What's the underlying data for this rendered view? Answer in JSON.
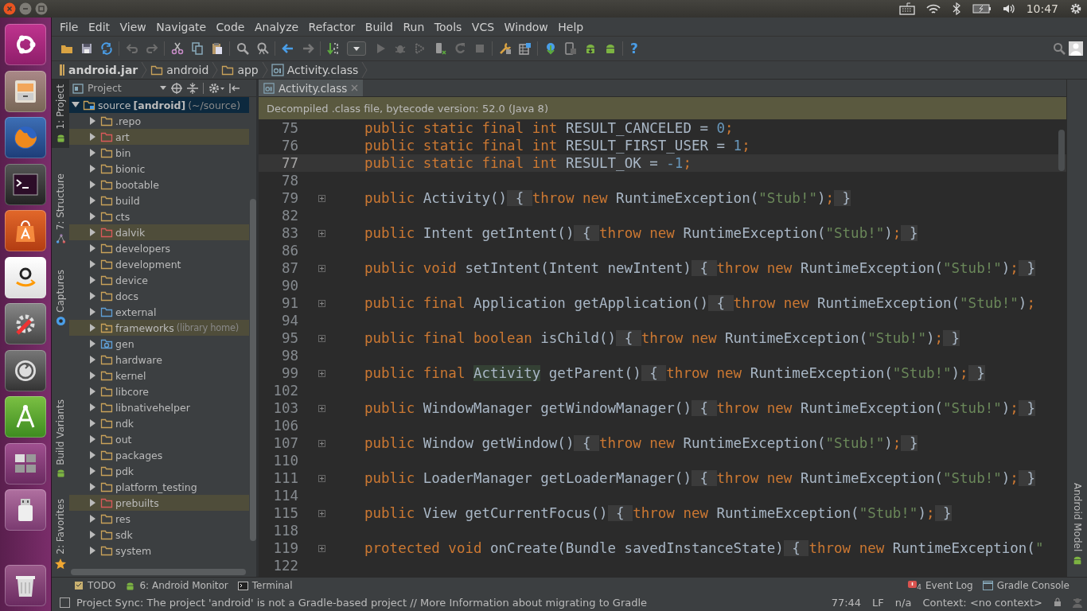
{
  "top_panel": {
    "clock": "10:47"
  },
  "menu": [
    "File",
    "Edit",
    "View",
    "Navigate",
    "Code",
    "Analyze",
    "Refactor",
    "Build",
    "Run",
    "Tools",
    "VCS",
    "Window",
    "Help"
  ],
  "toolbar": {
    "help_label": "?"
  },
  "breadcrumb": [
    {
      "label": "android.jar",
      "kind": "jar"
    },
    {
      "label": "android",
      "kind": "folder"
    },
    {
      "label": "app",
      "kind": "folder"
    },
    {
      "label": "Activity.class",
      "kind": "class"
    }
  ],
  "tool_tabs_left": [
    {
      "label": "1: Project",
      "selected": true
    },
    {
      "label": "7: Structure",
      "selected": false
    },
    {
      "label": "Captures",
      "selected": false
    },
    {
      "label": "Build Variants",
      "selected": false
    },
    {
      "label": "2: Favorites",
      "selected": false
    }
  ],
  "tool_tabs_right": [
    {
      "label": "Android Model",
      "selected": false
    }
  ],
  "project_panel": {
    "title": "Project",
    "root": {
      "name": "source",
      "module": "[android]",
      "path": "(~/source)",
      "expanded": true,
      "selected": true,
      "children": [
        {
          "label": ".repo",
          "kind": "folder",
          "expanded": false,
          "highlighted": false
        },
        {
          "label": "art",
          "kind": "excluded",
          "expanded": false,
          "highlighted": true
        },
        {
          "label": "bin",
          "kind": "folder",
          "expanded": false,
          "highlighted": false
        },
        {
          "label": "bionic",
          "kind": "folder",
          "expanded": false,
          "highlighted": false
        },
        {
          "label": "bootable",
          "kind": "folder",
          "expanded": false,
          "highlighted": false
        },
        {
          "label": "build",
          "kind": "folder",
          "expanded": false,
          "highlighted": false
        },
        {
          "label": "cts",
          "kind": "folder",
          "expanded": false,
          "highlighted": false
        },
        {
          "label": "dalvik",
          "kind": "excluded",
          "expanded": false,
          "highlighted": true
        },
        {
          "label": "developers",
          "kind": "folder",
          "expanded": false,
          "highlighted": false
        },
        {
          "label": "development",
          "kind": "folder",
          "expanded": false,
          "highlighted": false
        },
        {
          "label": "device",
          "kind": "folder",
          "expanded": false,
          "highlighted": false
        },
        {
          "label": "docs",
          "kind": "folder",
          "expanded": false,
          "highlighted": false
        },
        {
          "label": "external",
          "kind": "external",
          "expanded": false,
          "highlighted": false
        },
        {
          "label": "frameworks",
          "note": "(library home)",
          "kind": "library",
          "expanded": false,
          "highlighted": true
        },
        {
          "label": "gen",
          "kind": "generated",
          "expanded": false,
          "highlighted": false
        },
        {
          "label": "hardware",
          "kind": "folder",
          "expanded": false,
          "highlighted": false
        },
        {
          "label": "kernel",
          "kind": "folder",
          "expanded": false,
          "highlighted": false
        },
        {
          "label": "libcore",
          "kind": "folder",
          "expanded": false,
          "highlighted": false
        },
        {
          "label": "libnativehelper",
          "kind": "folder",
          "expanded": false,
          "highlighted": false
        },
        {
          "label": "ndk",
          "kind": "folder",
          "expanded": false,
          "highlighted": false
        },
        {
          "label": "out",
          "kind": "folder",
          "expanded": false,
          "highlighted": false
        },
        {
          "label": "packages",
          "kind": "folder",
          "expanded": false,
          "highlighted": false
        },
        {
          "label": "pdk",
          "kind": "folder",
          "expanded": false,
          "highlighted": false
        },
        {
          "label": "platform_testing",
          "kind": "folder",
          "expanded": false,
          "highlighted": false
        },
        {
          "label": "prebuilts",
          "kind": "excluded",
          "expanded": false,
          "highlighted": true
        },
        {
          "label": "res",
          "kind": "folder",
          "expanded": false,
          "highlighted": false
        },
        {
          "label": "sdk",
          "kind": "folder",
          "expanded": false,
          "highlighted": false
        },
        {
          "label": "system",
          "kind": "folder",
          "expanded": false,
          "highlighted": false
        }
      ]
    }
  },
  "editor": {
    "tabs": [
      {
        "label": "Activity.class",
        "selected": true
      }
    ],
    "banner": "Decompiled .class file, bytecode version: 52.0 (Java 8)",
    "lines": [
      {
        "number": "75",
        "current": false,
        "tokens": [
          {
            "kind": "keyword",
            "text": "public static final int "
          },
          {
            "kind": "name",
            "text": "RESULT_CANCELED = "
          },
          {
            "kind": "number",
            "text": "0"
          },
          {
            "kind": "semicolon",
            "text": ";"
          }
        ]
      },
      {
        "number": "76",
        "current": false,
        "tokens": [
          {
            "kind": "keyword",
            "text": "public static final int "
          },
          {
            "kind": "name",
            "text": "RESULT_FIRST_USER = "
          },
          {
            "kind": "number",
            "text": "1"
          },
          {
            "kind": "semicolon",
            "text": ";"
          }
        ]
      },
      {
        "number": "77",
        "current": true,
        "tokens": [
          {
            "kind": "keyword",
            "text": "public static final int "
          },
          {
            "kind": "name",
            "text": "RESULT_OK = "
          },
          {
            "kind": "number",
            "text": "-1"
          },
          {
            "kind": "semicolon",
            "text": ";"
          }
        ]
      },
      {
        "number": "78",
        "current": false
      },
      {
        "number": "79",
        "current": false,
        "tokens": [
          {
            "kind": "keyword",
            "text": "public "
          },
          {
            "kind": "name",
            "text": "Activity()"
          },
          {
            "kind": "fold",
            "text": " { "
          },
          {
            "kind": "keyword",
            "text": "throw new "
          },
          {
            "kind": "name",
            "text": "RuntimeException("
          },
          {
            "kind": "string",
            "text": "\"Stub!\""
          },
          {
            "kind": "name",
            "text": ")"
          },
          {
            "kind": "semicolon",
            "text": ";"
          },
          {
            "kind": "fold",
            "text": " }"
          }
        ]
      },
      {
        "number": "82",
        "current": false
      },
      {
        "number": "83",
        "current": false,
        "tokens": [
          {
            "kind": "keyword",
            "text": "public "
          },
          {
            "kind": "name",
            "text": "Intent getIntent()"
          },
          {
            "kind": "fold",
            "text": " { "
          },
          {
            "kind": "keyword",
            "text": "throw new "
          },
          {
            "kind": "name",
            "text": "RuntimeException("
          },
          {
            "kind": "string",
            "text": "\"Stub!\""
          },
          {
            "kind": "name",
            "text": ")"
          },
          {
            "kind": "semicolon",
            "text": ";"
          },
          {
            "kind": "fold",
            "text": " }"
          }
        ]
      },
      {
        "number": "86",
        "current": false
      },
      {
        "number": "87",
        "current": false,
        "tokens": [
          {
            "kind": "keyword",
            "text": "public void "
          },
          {
            "kind": "name",
            "text": "setIntent(Intent newIntent)"
          },
          {
            "kind": "fold",
            "text": " { "
          },
          {
            "kind": "keyword",
            "text": "throw new "
          },
          {
            "kind": "name",
            "text": "RuntimeException("
          },
          {
            "kind": "string",
            "text": "\"Stub!\""
          },
          {
            "kind": "name",
            "text": ")"
          },
          {
            "kind": "semicolon",
            "text": ";"
          },
          {
            "kind": "fold",
            "text": " }"
          }
        ]
      },
      {
        "number": "90",
        "current": false
      },
      {
        "number": "91",
        "current": false,
        "tokens": [
          {
            "kind": "keyword",
            "text": "public final "
          },
          {
            "kind": "name",
            "text": "Application getApplication()"
          },
          {
            "kind": "fold",
            "text": " { "
          },
          {
            "kind": "keyword",
            "text": "throw new "
          },
          {
            "kind": "name",
            "text": "RuntimeException("
          },
          {
            "kind": "string",
            "text": "\"Stub!\""
          },
          {
            "kind": "name",
            "text": ")"
          },
          {
            "kind": "semicolon",
            "text": ";"
          }
        ]
      },
      {
        "number": "94",
        "current": false
      },
      {
        "number": "95",
        "current": false,
        "tokens": [
          {
            "kind": "keyword",
            "text": "public final boolean "
          },
          {
            "kind": "name",
            "text": "isChild()"
          },
          {
            "kind": "fold",
            "text": " { "
          },
          {
            "kind": "keyword",
            "text": "throw new "
          },
          {
            "kind": "name",
            "text": "RuntimeException("
          },
          {
            "kind": "string",
            "text": "\"Stub!\""
          },
          {
            "kind": "name",
            "text": ")"
          },
          {
            "kind": "semicolon",
            "text": ";"
          },
          {
            "kind": "fold",
            "text": " }"
          }
        ]
      },
      {
        "number": "98",
        "current": false
      },
      {
        "number": "99",
        "current": false,
        "tokens": [
          {
            "kind": "keyword",
            "text": "public final "
          },
          {
            "kind": "reference",
            "text": "Activity"
          },
          {
            "kind": "name",
            "text": " getParent()"
          },
          {
            "kind": "fold",
            "text": " { "
          },
          {
            "kind": "keyword",
            "text": "throw new "
          },
          {
            "kind": "name",
            "text": "RuntimeException("
          },
          {
            "kind": "string",
            "text": "\"Stub!\""
          },
          {
            "kind": "name",
            "text": ")"
          },
          {
            "kind": "semicolon",
            "text": ";"
          },
          {
            "kind": "fold",
            "text": " }"
          }
        ]
      },
      {
        "number": "102",
        "current": false
      },
      {
        "number": "103",
        "current": false,
        "tokens": [
          {
            "kind": "keyword",
            "text": "public "
          },
          {
            "kind": "name",
            "text": "WindowManager getWindowManager()"
          },
          {
            "kind": "fold",
            "text": " { "
          },
          {
            "kind": "keyword",
            "text": "throw new "
          },
          {
            "kind": "name",
            "text": "RuntimeException("
          },
          {
            "kind": "string",
            "text": "\"Stub!\""
          },
          {
            "kind": "name",
            "text": ")"
          },
          {
            "kind": "semicolon",
            "text": ";"
          },
          {
            "kind": "fold",
            "text": " }"
          }
        ]
      },
      {
        "number": "106",
        "current": false
      },
      {
        "number": "107",
        "current": false,
        "tokens": [
          {
            "kind": "keyword",
            "text": "public "
          },
          {
            "kind": "name",
            "text": "Window getWindow()"
          },
          {
            "kind": "fold",
            "text": " { "
          },
          {
            "kind": "keyword",
            "text": "throw new "
          },
          {
            "kind": "name",
            "text": "RuntimeException("
          },
          {
            "kind": "string",
            "text": "\"Stub!\""
          },
          {
            "kind": "name",
            "text": ")"
          },
          {
            "kind": "semicolon",
            "text": ";"
          },
          {
            "kind": "fold",
            "text": " }"
          }
        ]
      },
      {
        "number": "110",
        "current": false
      },
      {
        "number": "111",
        "current": false,
        "tokens": [
          {
            "kind": "keyword",
            "text": "public "
          },
          {
            "kind": "name",
            "text": "LoaderManager getLoaderManager()"
          },
          {
            "kind": "fold",
            "text": " { "
          },
          {
            "kind": "keyword",
            "text": "throw new "
          },
          {
            "kind": "name",
            "text": "RuntimeException("
          },
          {
            "kind": "string",
            "text": "\"Stub!\""
          },
          {
            "kind": "name",
            "text": ")"
          },
          {
            "kind": "semicolon",
            "text": ";"
          },
          {
            "kind": "fold",
            "text": " }"
          }
        ]
      },
      {
        "number": "114",
        "current": false
      },
      {
        "number": "115",
        "current": false,
        "tokens": [
          {
            "kind": "keyword",
            "text": "public "
          },
          {
            "kind": "name",
            "text": "View getCurrentFocus()"
          },
          {
            "kind": "fold",
            "text": " { "
          },
          {
            "kind": "keyword",
            "text": "throw new "
          },
          {
            "kind": "name",
            "text": "RuntimeException("
          },
          {
            "kind": "string",
            "text": "\"Stub!\""
          },
          {
            "kind": "name",
            "text": ")"
          },
          {
            "kind": "semicolon",
            "text": ";"
          },
          {
            "kind": "fold",
            "text": " }"
          }
        ]
      },
      {
        "number": "118",
        "current": false
      },
      {
        "number": "119",
        "current": false,
        "tokens": [
          {
            "kind": "keyword",
            "text": "protected void "
          },
          {
            "kind": "name",
            "text": "onCreate(Bundle savedInstanceState)"
          },
          {
            "kind": "fold",
            "text": " { "
          },
          {
            "kind": "keyword",
            "text": "throw new "
          },
          {
            "kind": "name",
            "text": "RuntimeException("
          },
          {
            "kind": "string",
            "text": "\""
          }
        ]
      },
      {
        "number": "122",
        "current": false
      }
    ]
  },
  "tool_windows_bar": {
    "left": [
      {
        "label": "TODO",
        "kind": "todo"
      },
      {
        "label": "6: Android Monitor",
        "kind": "android"
      },
      {
        "label": "Terminal",
        "kind": "terminal"
      }
    ],
    "right": [
      {
        "label": "Event Log",
        "kind": "event",
        "badge": "4"
      },
      {
        "label": "Gradle Console",
        "kind": "console"
      }
    ]
  },
  "status_bar": {
    "message": "Project Sync: The project 'android' is not a Gradle-based project // More Information about migrating to Gradle",
    "position": "77:44",
    "line_separator": "LF",
    "encoding": "n/a",
    "context": "Context: <no context>"
  }
}
